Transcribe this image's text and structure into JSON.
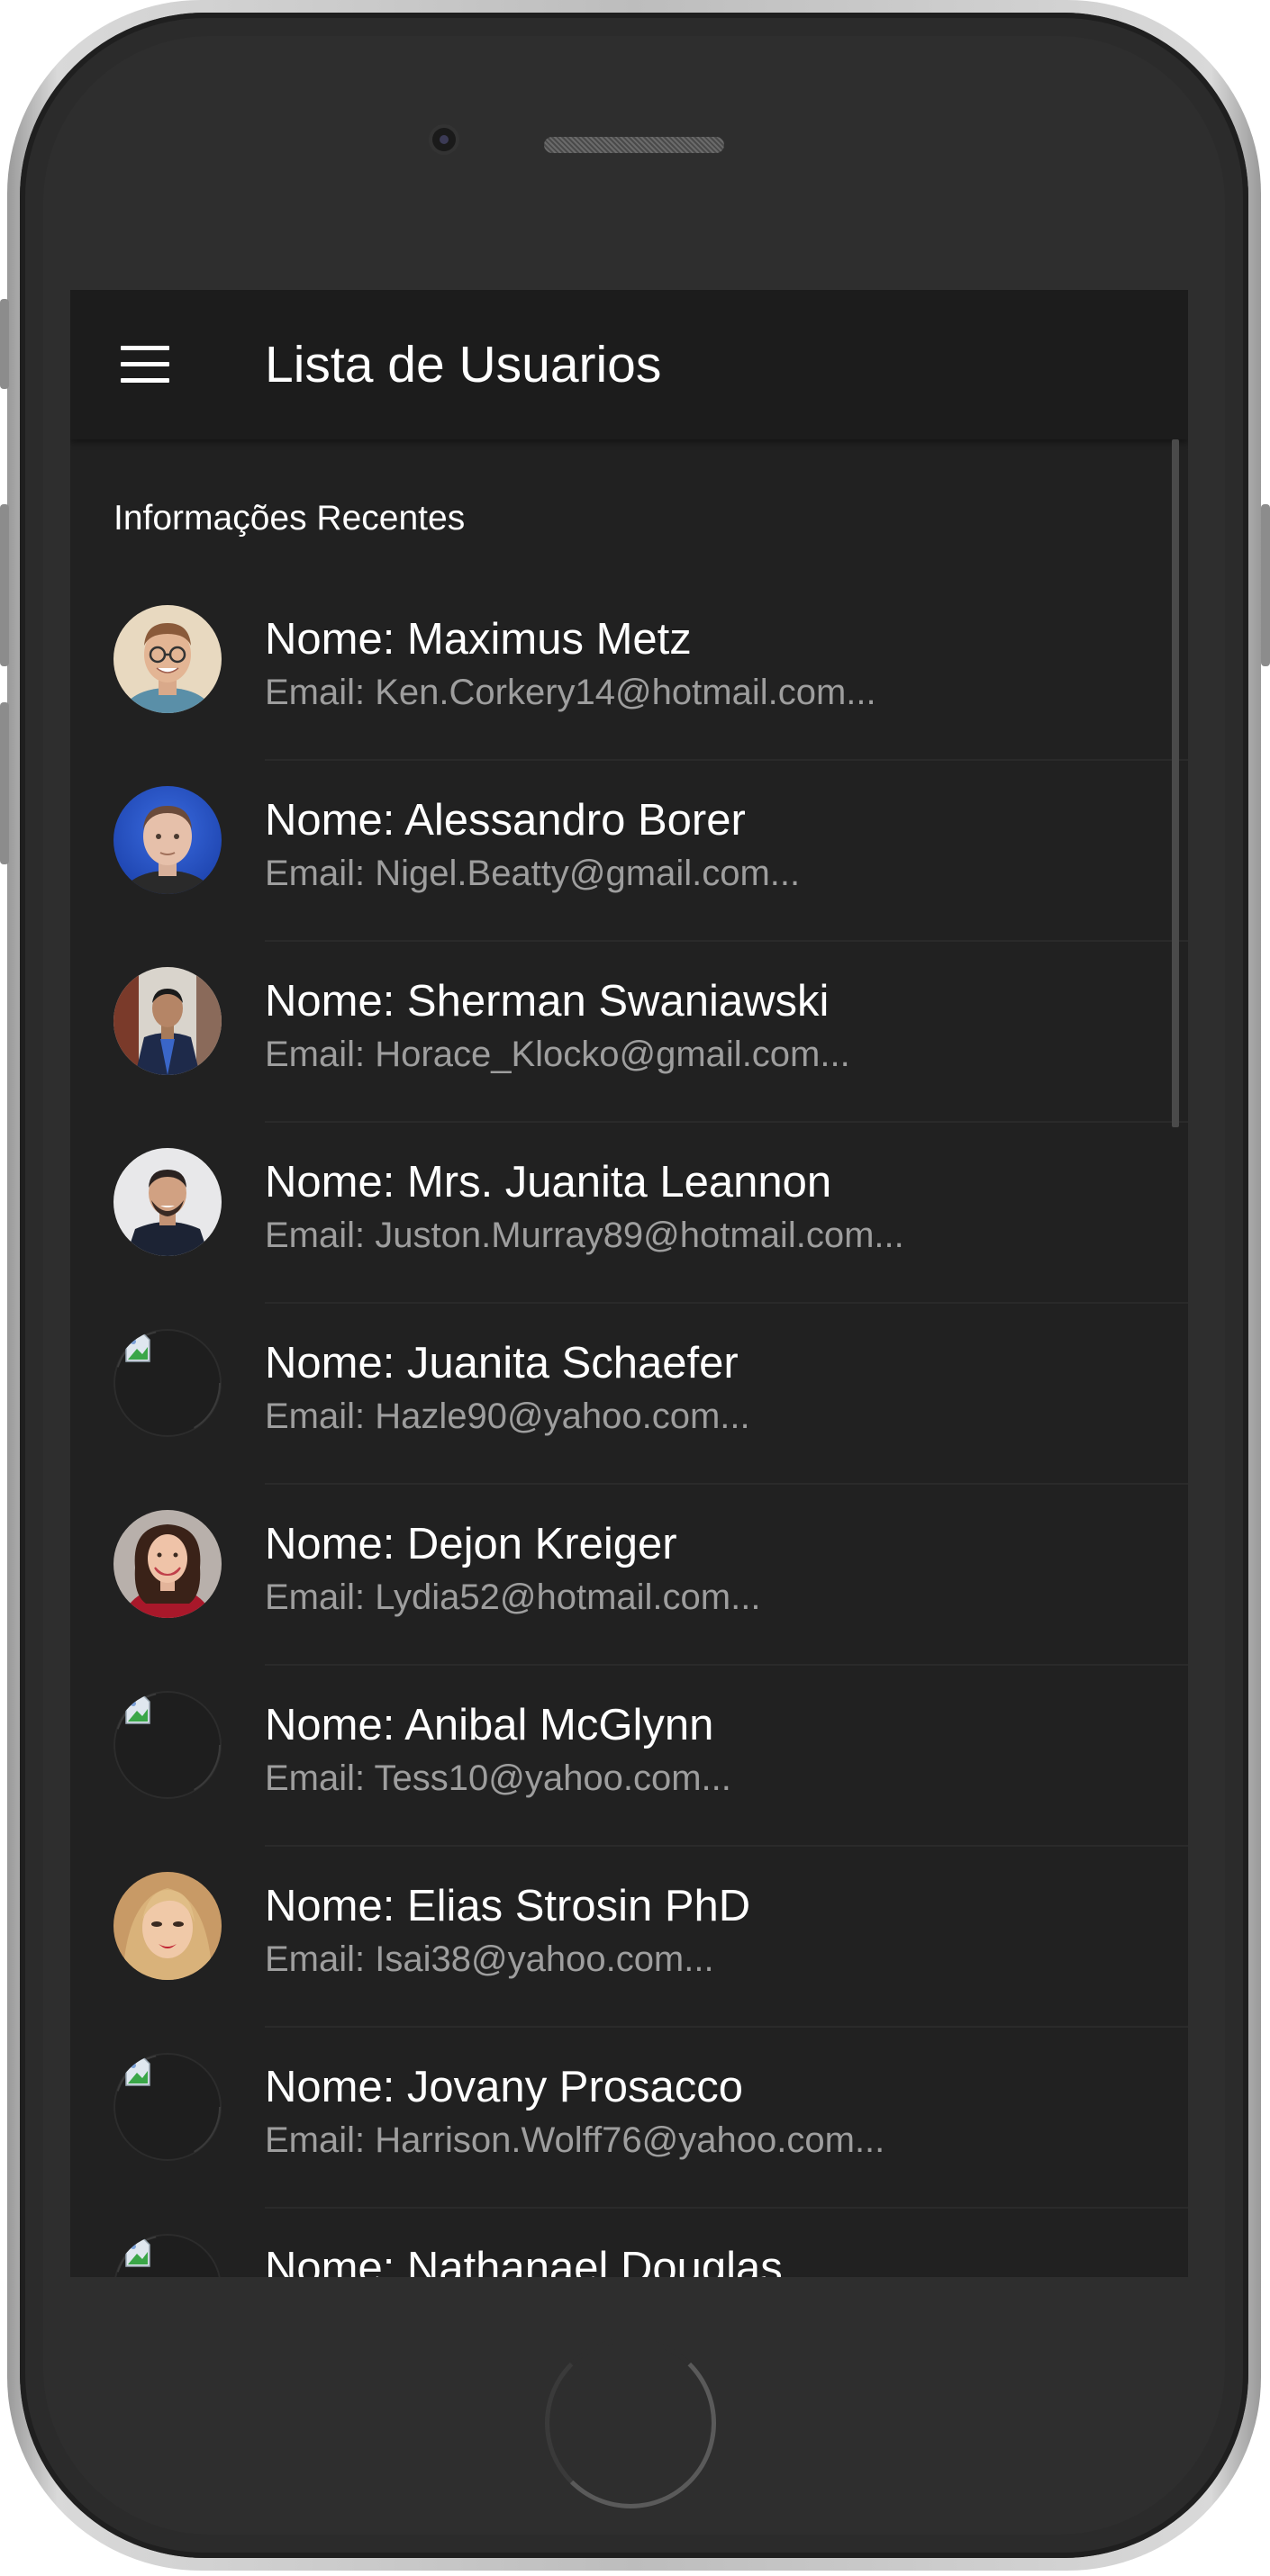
{
  "app_bar": {
    "title": "Lista de Usuarios",
    "menu_icon": "hamburger-menu-icon"
  },
  "list": {
    "section_header": "Informações Recentes",
    "users": [
      {
        "name": "Nome: Maximus Metz",
        "email": "Email: Ken.Corkery14@hotmail.com...",
        "avatar": "photo"
      },
      {
        "name": "Nome: Alessandro Borer",
        "email": "Email: Nigel.Beatty@gmail.com...",
        "avatar": "photo"
      },
      {
        "name": "Nome: Sherman Swaniawski",
        "email": "Email: Horace_Klocko@gmail.com...",
        "avatar": "photo"
      },
      {
        "name": "Nome: Mrs. Juanita Leannon",
        "email": "Email: Juston.Murray89@hotmail.com...",
        "avatar": "photo"
      },
      {
        "name": "Nome: Juanita Schaefer",
        "email": "Email: Hazle90@yahoo.com...",
        "avatar": "broken-image"
      },
      {
        "name": "Nome: Dejon Kreiger",
        "email": "Email: Lydia52@hotmail.com...",
        "avatar": "photo"
      },
      {
        "name": "Nome: Anibal McGlynn",
        "email": "Email: Tess10@yahoo.com...",
        "avatar": "broken-image"
      },
      {
        "name": "Nome: Elias Strosin PhD",
        "email": "Email: Isai38@yahoo.com...",
        "avatar": "photo"
      },
      {
        "name": "Nome: Jovany Prosacco",
        "email": "Email: Harrison.Wolff76@yahoo.com...",
        "avatar": "broken-image"
      },
      {
        "name": "Nome: Nathanael Douglas",
        "email": "",
        "avatar": "broken-image"
      }
    ]
  },
  "colors": {
    "background": "#212121",
    "app_bar": "#1c1c1c",
    "primary_text": "#ffffff",
    "secondary_text": "#9e9e9e"
  }
}
